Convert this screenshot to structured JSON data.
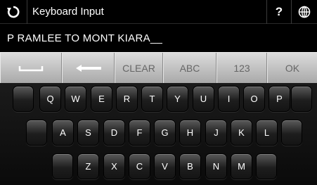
{
  "titlebar": {
    "back_icon": "refresh-back-icon",
    "title": "Keyboard Input",
    "help_label": "?",
    "globe_icon": "globe-icon"
  },
  "input": {
    "value": "P RAMLEE TO MONT KIARA__"
  },
  "function_keys": [
    {
      "name": "space-key",
      "label": "",
      "icon": "space-bar-icon"
    },
    {
      "name": "backspace-key",
      "label": "",
      "icon": "arrow-left-icon"
    },
    {
      "name": "clear-key",
      "label": "CLEAR"
    },
    {
      "name": "abc-key",
      "label": "ABC"
    },
    {
      "name": "numbers-key",
      "label": "123"
    },
    {
      "name": "ok-key",
      "label": "OK"
    }
  ],
  "keyboard": {
    "row1": [
      "Q",
      "W",
      "E",
      "R",
      "T",
      "Y",
      "U",
      "I",
      "O",
      "P"
    ],
    "row2": [
      "A",
      "S",
      "D",
      "F",
      "G",
      "H",
      "J",
      "K",
      "L"
    ],
    "row3": [
      "Z",
      "X",
      "C",
      "V",
      "B",
      "N",
      "M"
    ]
  },
  "colors": {
    "background": "#000000",
    "function_row": "#c8c8c8",
    "key_text": "#ffffff"
  }
}
